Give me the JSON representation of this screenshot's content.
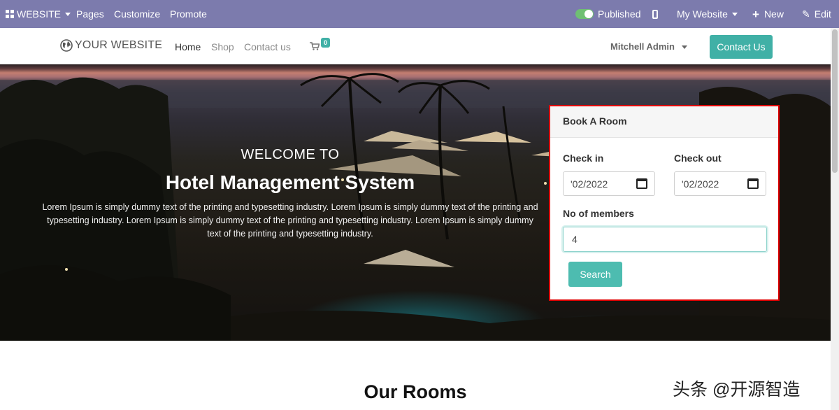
{
  "admin_bar": {
    "website_menu": "WEBSITE",
    "pages": "Pages",
    "customize": "Customize",
    "promote": "Promote",
    "published": "Published",
    "my_website": "My Website",
    "new": "New",
    "edit": "Edit"
  },
  "header": {
    "logo": "YOUR WEBSITE",
    "nav": [
      "Home",
      "Shop",
      "Contact us"
    ],
    "cart_count": "0",
    "user": "Mitchell Admin",
    "contact_button": "Contact Us"
  },
  "hero": {
    "welcome": "WELCOME TO",
    "title": "Hotel Management System",
    "description": "Lorem Ipsum is simply dummy text of the printing and typesetting industry. Lorem Ipsum is simply dummy text of the printing and typesetting industry. Lorem Ipsum is simply dummy text of the printing and typesetting industry. Lorem Ipsum is simply dummy text of the printing and typesetting industry."
  },
  "booking": {
    "title": "Book A Room",
    "check_in_label": "Check in",
    "check_in_value": "'02/2022",
    "check_out_label": "Check out",
    "check_out_value": "'02/2022",
    "members_label": "No of members",
    "members_value": "4",
    "search_button": "Search"
  },
  "section": {
    "title": "Our Rooms"
  },
  "watermark": "头条 @开源智造",
  "colors": {
    "admin_bar": "#7c7bad",
    "accent": "#40b0a6",
    "highlight_border": "#e00000"
  }
}
